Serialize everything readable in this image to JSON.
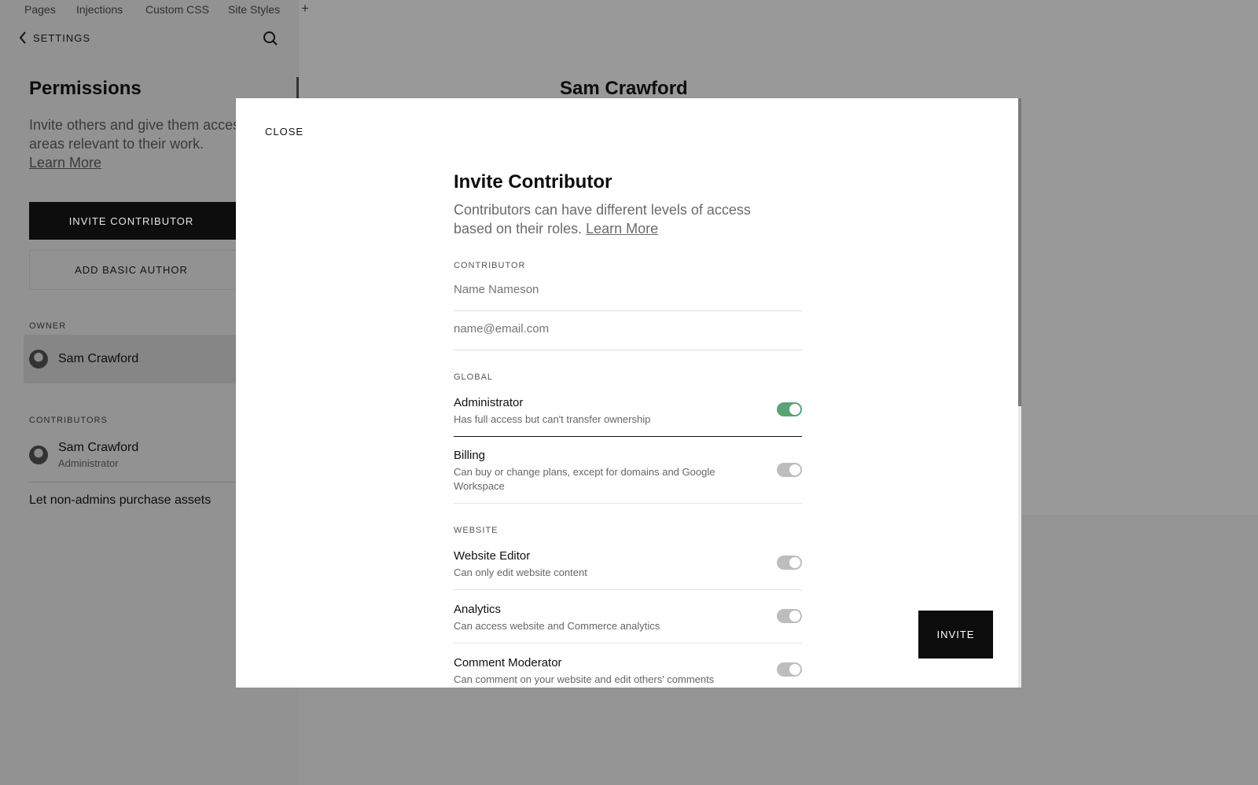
{
  "top_tabs": [
    "Pages",
    "Injections",
    "Custom CSS",
    "Site Styles",
    "+"
  ],
  "sidebar": {
    "back_label": "SETTINGS",
    "title": "Permissions",
    "description": "Invite others and give them access to areas relevant to their work.",
    "learn_more": "Learn More",
    "invite_button": "INVITE CONTRIBUTOR",
    "basic_author_button": "ADD BASIC AUTHOR",
    "owner_label": "OWNER",
    "owner_name": "Sam Crawford",
    "contributors_label": "CONTRIBUTORS",
    "contributors": [
      {
        "name": "Sam Crawford",
        "role": "Administrator"
      }
    ],
    "purchase_setting": "Let non-admins purchase assets"
  },
  "main": {
    "heading": "Sam Crawford"
  },
  "modal": {
    "close": "CLOSE",
    "title": "Invite Contributor",
    "description": "Contributors can have different levels of access based on their roles.",
    "learn_more": "Learn More",
    "contributor_label": "CONTRIBUTOR",
    "name_placeholder": "Name Nameson",
    "email_placeholder": "name@email.com",
    "global_label": "GLOBAL",
    "website_label": "WEBSITE",
    "permissions": [
      {
        "title": "Administrator",
        "desc": "Has full access but can't transfer ownership",
        "on": true
      },
      {
        "title": "Billing",
        "desc": "Can buy or change plans, except for domains and Google Workspace",
        "on": false
      },
      {
        "title": "Website Editor",
        "desc": "Can only edit website content",
        "on": false
      },
      {
        "title": "Analytics",
        "desc": "Can access website and Commerce analytics",
        "on": false
      },
      {
        "title": "Comment Moderator",
        "desc": "Can comment on your website and edit others' comments",
        "on": false
      }
    ],
    "invite_button": "INVITE",
    "toggle_on_color": "#5aa377"
  }
}
